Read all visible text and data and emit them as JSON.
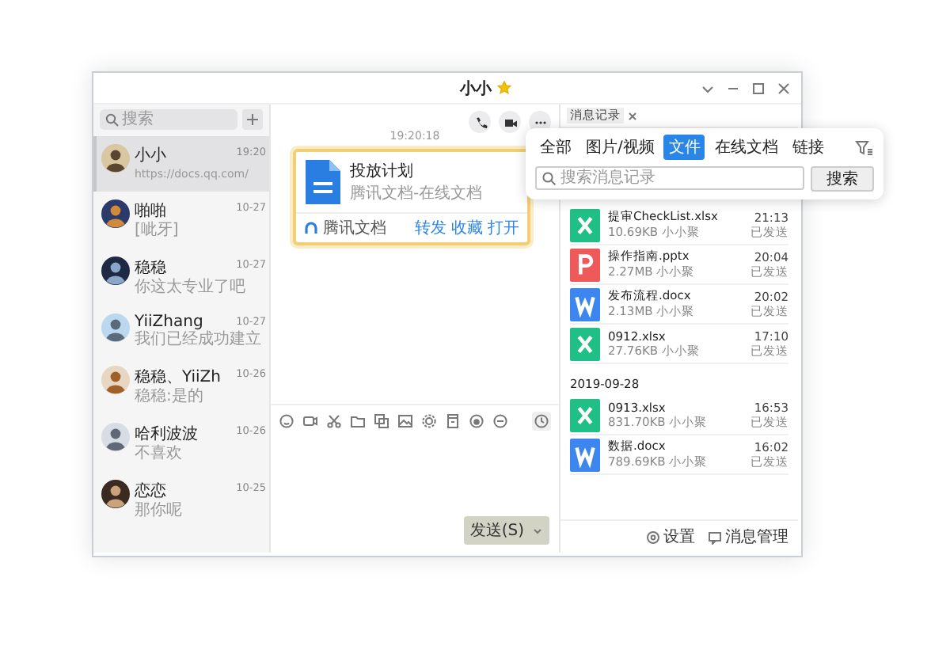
{
  "window": {
    "title": "小小",
    "starred": true
  },
  "sidebar": {
    "search": {
      "placeholder": "搜索"
    },
    "contacts": [
      {
        "name": "小小",
        "preview": "https://docs.qq.com/",
        "time": "19:20",
        "selected": true
      },
      {
        "name": "啪啪",
        "preview": "[呲牙]",
        "time": "10-27",
        "selected": false
      },
      {
        "name": "稳稳",
        "preview": "你这太专业了吧",
        "time": "10-27",
        "selected": false
      },
      {
        "name": "YiiZhang",
        "preview": "我们已经成功建立",
        "time": "10-27",
        "selected": false
      },
      {
        "name": "稳稳、YiiZh",
        "preview": "稳稳:是的",
        "time": "10-26",
        "selected": false
      },
      {
        "name": "哈利波波",
        "preview": "不喜欢",
        "time": "10-26",
        "selected": false
      },
      {
        "name": "恋恋",
        "preview": "那你呢",
        "time": "10-25",
        "selected": false
      }
    ]
  },
  "chat": {
    "timestamp": "19:20:18",
    "card": {
      "title": "投放计划",
      "subtitle": "腾讯文档-在线文档",
      "source": "腾讯文档",
      "actions": [
        "转发",
        "收藏",
        "打开"
      ]
    },
    "send_button": "发送(S)"
  },
  "history": {
    "tab": "消息记录",
    "filters": [
      {
        "label": "全部",
        "selected": false
      },
      {
        "label": "图片/视频",
        "selected": false
      },
      {
        "label": "文件",
        "selected": true
      },
      {
        "label": "在线文档",
        "selected": false
      },
      {
        "label": "链接",
        "selected": false
      }
    ],
    "search": {
      "placeholder": "搜索消息记录",
      "button": "搜索"
    },
    "groups": [
      {
        "files": [
          {
            "kind": "xlsx",
            "name": "提审CheckList.xlsx",
            "meta": "10.69KB 小小聚",
            "time": "21:13",
            "status": "已发送"
          },
          {
            "kind": "pptx",
            "name": "操作指南.pptx",
            "meta": "2.27MB 小小聚",
            "time": "20:04",
            "status": "已发送"
          },
          {
            "kind": "docx",
            "name": "发布流程.docx",
            "meta": "2.13MB 小小聚",
            "time": "20:02",
            "status": "已发送"
          },
          {
            "kind": "xlsx",
            "name": "0912.xlsx",
            "meta": "27.76KB 小小聚",
            "time": "17:10",
            "status": "已发送"
          }
        ]
      },
      {
        "date": "2019-09-28",
        "files": [
          {
            "kind": "xlsx",
            "name": "0913.xlsx",
            "meta": "831.70KB 小小聚",
            "time": "16:53",
            "status": "已发送"
          },
          {
            "kind": "docx",
            "name": "数据.docx",
            "meta": "789.69KB 小小聚",
            "time": "16:02",
            "status": "已发送"
          }
        ]
      }
    ],
    "footer": [
      "设置",
      "消息管理"
    ]
  }
}
